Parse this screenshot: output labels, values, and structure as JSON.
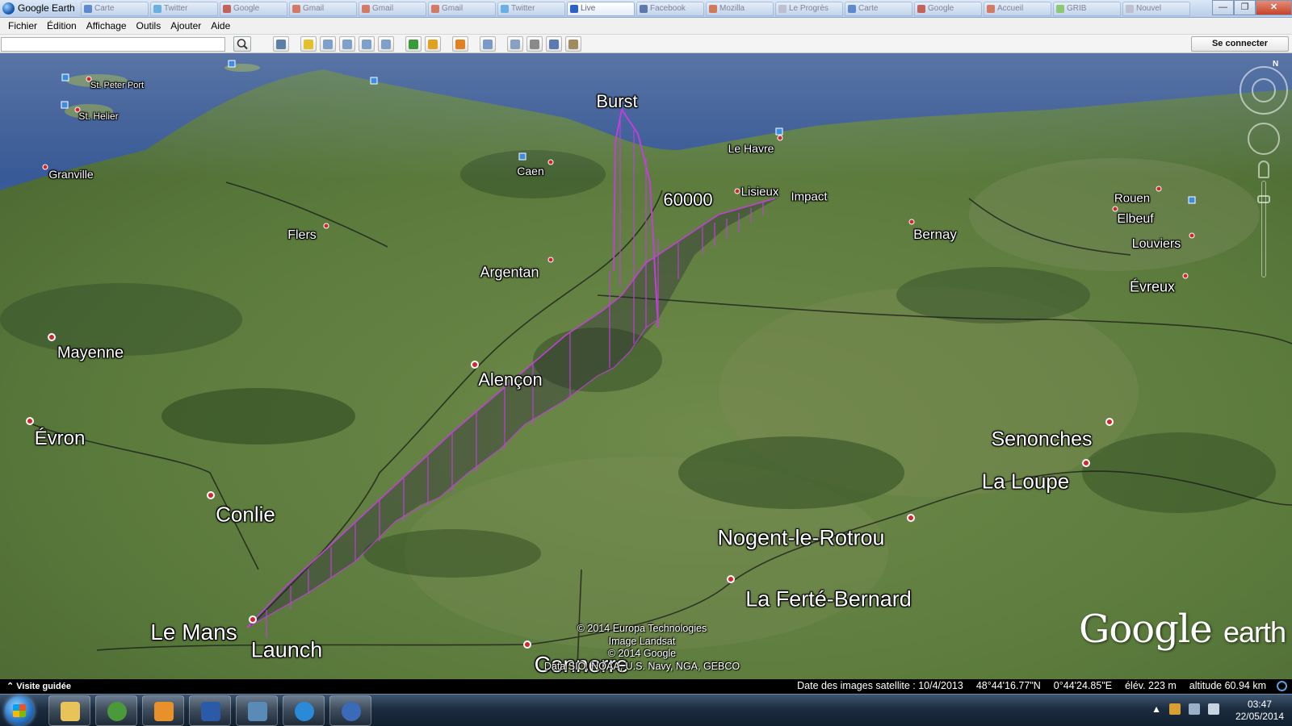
{
  "window": {
    "title": "Google Earth",
    "tabs": [
      {
        "label": "Carte",
        "color": "#3b6fc4"
      },
      {
        "label": "Twitter",
        "color": "#4aa3df"
      },
      {
        "label": "Google",
        "color": "#c23b2a"
      },
      {
        "label": "Gmail",
        "color": "#d65a3a"
      },
      {
        "label": "Gmail",
        "color": "#d65a3a"
      },
      {
        "label": "Gmail",
        "color": "#d65a3a"
      },
      {
        "label": "Twitter",
        "color": "#4aa3df"
      },
      {
        "label": "Live",
        "color": "#2b62c4",
        "active": true
      },
      {
        "label": "Facebook",
        "color": "#3b5998"
      },
      {
        "label": "Mozilla",
        "color": "#d35a2a"
      },
      {
        "label": "Le Progrès",
        "color": "#b8b8c8"
      },
      {
        "label": "Carte",
        "color": "#3b6fc4"
      },
      {
        "label": "Google",
        "color": "#c23b2a"
      },
      {
        "label": "Accueil",
        "color": "#d65a3a"
      },
      {
        "label": "GRIB",
        "color": "#7cc04a"
      },
      {
        "label": "Nouvel",
        "color": "#b8b8c8"
      }
    ]
  },
  "menu": [
    "Fichier",
    "Édition",
    "Affichage",
    "Outils",
    "Ajouter",
    "Aide"
  ],
  "toolbar": {
    "search_value": "",
    "signin_label": "Se connecter",
    "icons": [
      {
        "name": "sidebar-icon",
        "color": "#5b7fa6"
      },
      {
        "name": "placemark-icon",
        "color": "#e3c12a"
      },
      {
        "name": "polygon-icon",
        "color": "#7fa0c8"
      },
      {
        "name": "path-icon",
        "color": "#7fa0c8"
      },
      {
        "name": "overlay-icon",
        "color": "#7fa0c8"
      },
      {
        "name": "tour-icon",
        "color": "#7fa0c8"
      },
      {
        "name": "history-icon",
        "color": "#3a9a3a"
      },
      {
        "name": "sun-icon",
        "color": "#e0a020"
      },
      {
        "name": "planet-icon",
        "color": "#e08020"
      },
      {
        "name": "ruler-icon",
        "color": "#7a9ac8"
      },
      {
        "name": "email-icon",
        "color": "#8aa0c0"
      },
      {
        "name": "print-icon",
        "color": "#8a8a8a"
      },
      {
        "name": "maps-icon",
        "color": "#5a7ab0"
      },
      {
        "name": "save-image-icon",
        "color": "#a08a60"
      }
    ]
  },
  "map": {
    "places": [
      {
        "name": "St. Peter Port",
        "size": 11
      },
      {
        "name": "St. Helier",
        "size": 12
      },
      {
        "name": "Granville",
        "size": 14
      },
      {
        "name": "Caen",
        "size": 14
      },
      {
        "name": "Le Havre",
        "size": 14
      },
      {
        "name": "Rouen",
        "size": 15
      },
      {
        "name": "Elbeuf",
        "size": 16
      },
      {
        "name": "Louviers",
        "size": 16
      },
      {
        "name": "Évreux",
        "size": 18
      },
      {
        "name": "Bernay",
        "size": 17
      },
      {
        "name": "Lisieux",
        "size": 15
      },
      {
        "name": "Flers",
        "size": 16
      },
      {
        "name": "Argentan",
        "size": 18
      },
      {
        "name": "Mayenne",
        "size": 20
      },
      {
        "name": "Alençon",
        "size": 22
      },
      {
        "name": "Évron",
        "size": 24
      },
      {
        "name": "Conlie",
        "size": 26
      },
      {
        "name": "Le Mans",
        "size": 28
      },
      {
        "name": "Connerre",
        "size": 28
      },
      {
        "name": "La Ferté-Bernard",
        "size": 27
      },
      {
        "name": "Nogent-le-Rotrou",
        "size": 27
      },
      {
        "name": "La Loupe",
        "size": 26
      },
      {
        "name": "Senonches",
        "size": 25
      }
    ],
    "markers": {
      "burst": "Burst",
      "launch": "Launch",
      "impact": "Impact",
      "altitude_label": "60000"
    },
    "track_color": "#c040d8",
    "credits": [
      "© 2014 Europa Technologies",
      "Image Landsat",
      "© 2014 Google",
      "Data SIO, NOAA, U.S. Navy, NGA, GEBCO"
    ],
    "logo": {
      "main": "Google",
      "sub": "earth"
    },
    "compass_label": "N"
  },
  "status": {
    "tour_label": "Visite guidée",
    "imagery_date": "Date des images satellite : 10/4/2013",
    "lat": "48°44'16.77\"N",
    "lon": "0°44'24.85\"E",
    "elev": "élév.  223 m",
    "altitude": "altitude  60.94 km"
  },
  "taskbar": {
    "apps": [
      {
        "name": "explorer",
        "color": "#e8c35a"
      },
      {
        "name": "chrome",
        "color": "#4a9a3a"
      },
      {
        "name": "media-player",
        "color": "#e8902a"
      },
      {
        "name": "word",
        "color": "#2a5aa8"
      },
      {
        "name": "pictures",
        "color": "#5a8ab8"
      },
      {
        "name": "internet-explorer",
        "color": "#2a8ad8"
      },
      {
        "name": "google-earth",
        "color": "#3a6ab8"
      }
    ],
    "time": "03:47",
    "date": "22/05/2014"
  }
}
